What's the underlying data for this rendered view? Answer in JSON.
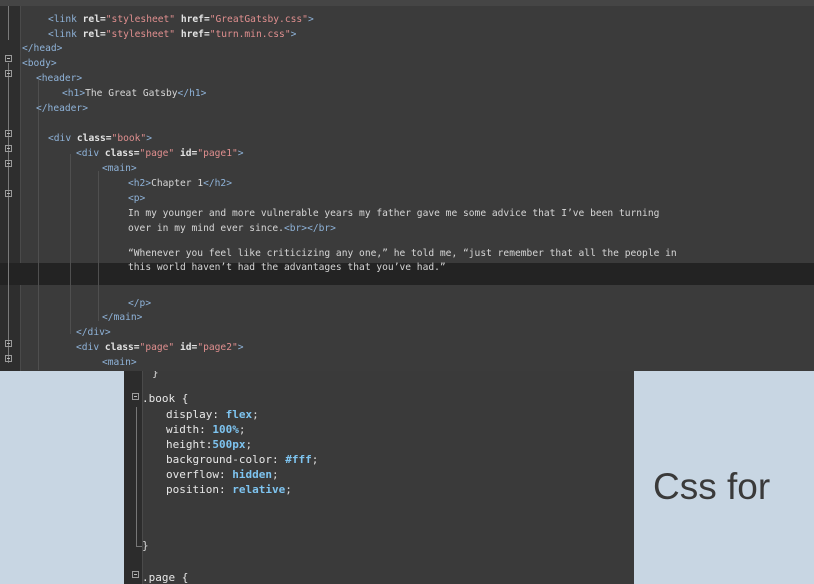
{
  "html_code": {
    "l1": {
      "t1": "<link ",
      "a1": "rel=",
      "s1": "\"stylesheet\"",
      "a2": " href=",
      "s2": "\"GreatGatsby.css\"",
      "t2": ">"
    },
    "l2": {
      "t1": "<link ",
      "a1": "rel=",
      "s1": "\"stylesheet\"",
      "a2": " href=",
      "s2": "\"turn.min.css\"",
      "t2": ">"
    },
    "l3": "</head>",
    "l4": "<body>",
    "l5": "<header>",
    "l6": {
      "t1": "<h1>",
      "txt": "The Great Gatsby",
      "t2": "</h1>"
    },
    "l7": "</header>",
    "l8": {
      "t1": "<div ",
      "a1": "class=",
      "s1": "\"book\"",
      "t2": ">"
    },
    "l9": {
      "t1": "<div ",
      "a1": "class=",
      "s1": "\"page\"",
      "a2": " id=",
      "s2": "\"page1\"",
      "t2": ">"
    },
    "l10": "<main>",
    "l11": {
      "t1": "<h2>",
      "txt": "Chapter 1",
      "t2": "</h2>"
    },
    "l12": "<p>",
    "l13": "In my younger and more vulnerable years my father gave me some advice that I’ve been turning",
    "l14": {
      "txt": "over in my mind ever since.",
      "t1": "<br>",
      "t2": "</br>"
    },
    "l15": "“Whenever you feel like criticizing any one,” he told me, “just remember that all the people in",
    "l16": "this world haven’t had the advantages that you’ve had.”",
    "l17": "</p>",
    "l18": "</main>",
    "l19": "</div>",
    "l20": {
      "t1": "<div ",
      "a1": "class=",
      "s1": "\"page\"",
      "a2": " id=",
      "s2": "\"page2\"",
      "t2": ">"
    },
    "l21": "<main>"
  },
  "css_code": {
    "top_brace": "}",
    "selector1": ".book {",
    "props": [
      {
        "name": "display: ",
        "value": "flex",
        "end": ";"
      },
      {
        "name": "width: ",
        "value": "100%",
        "end": ";"
      },
      {
        "name": "height:",
        "value": "500px",
        "end": ";"
      },
      {
        "name": "background-color: ",
        "value": "#fff",
        "end": ";"
      },
      {
        "name": "overflow: ",
        "value": "hidden",
        "end": ";"
      },
      {
        "name": "position: ",
        "value": "relative",
        "end": ";"
      }
    ],
    "close_brace": "}",
    "selector2": ".page {"
  },
  "caption": "Css for"
}
